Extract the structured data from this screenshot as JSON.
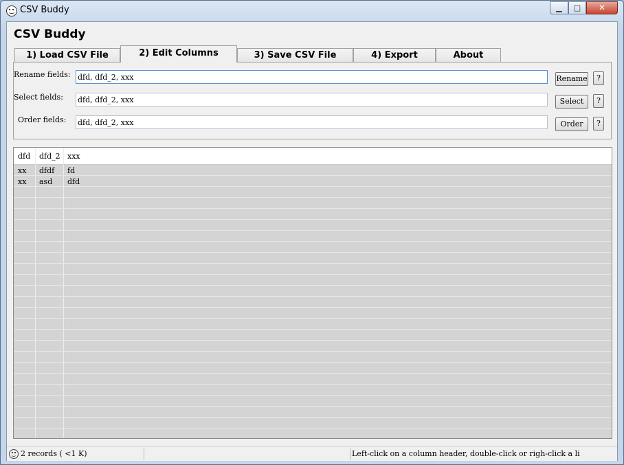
{
  "window": {
    "title": "CSV Buddy"
  },
  "app": {
    "heading": "CSV Buddy"
  },
  "tabs": [
    {
      "label": "1) Load CSV File"
    },
    {
      "label": "2) Edit Columns"
    },
    {
      "label": "3) Save CSV File"
    },
    {
      "label": "4) Export"
    },
    {
      "label": "About"
    }
  ],
  "active_tab": "2) Edit Columns",
  "fields": {
    "rename": {
      "label": "Rename fields:",
      "value": "dfd, dfd_2, xxx",
      "button": "Rename",
      "help": "?"
    },
    "select": {
      "label": "Select fields:",
      "value": "dfd, dfd_2, xxx",
      "button": "Select",
      "help": "?"
    },
    "order": {
      "label": "Order fields:",
      "value": "dfd, dfd_2, xxx",
      "button": "Order",
      "help": "?"
    }
  },
  "table": {
    "columns": [
      "dfd",
      "dfd_2",
      "xxx"
    ],
    "rows": [
      [
        "xx",
        "dfdf",
        "fd"
      ],
      [
        "xx",
        "asd",
        "dfd"
      ]
    ]
  },
  "status": {
    "records": "2 records ( <1 K)",
    "hint": "Left-click on a column header, double-click or righ-click a li"
  }
}
